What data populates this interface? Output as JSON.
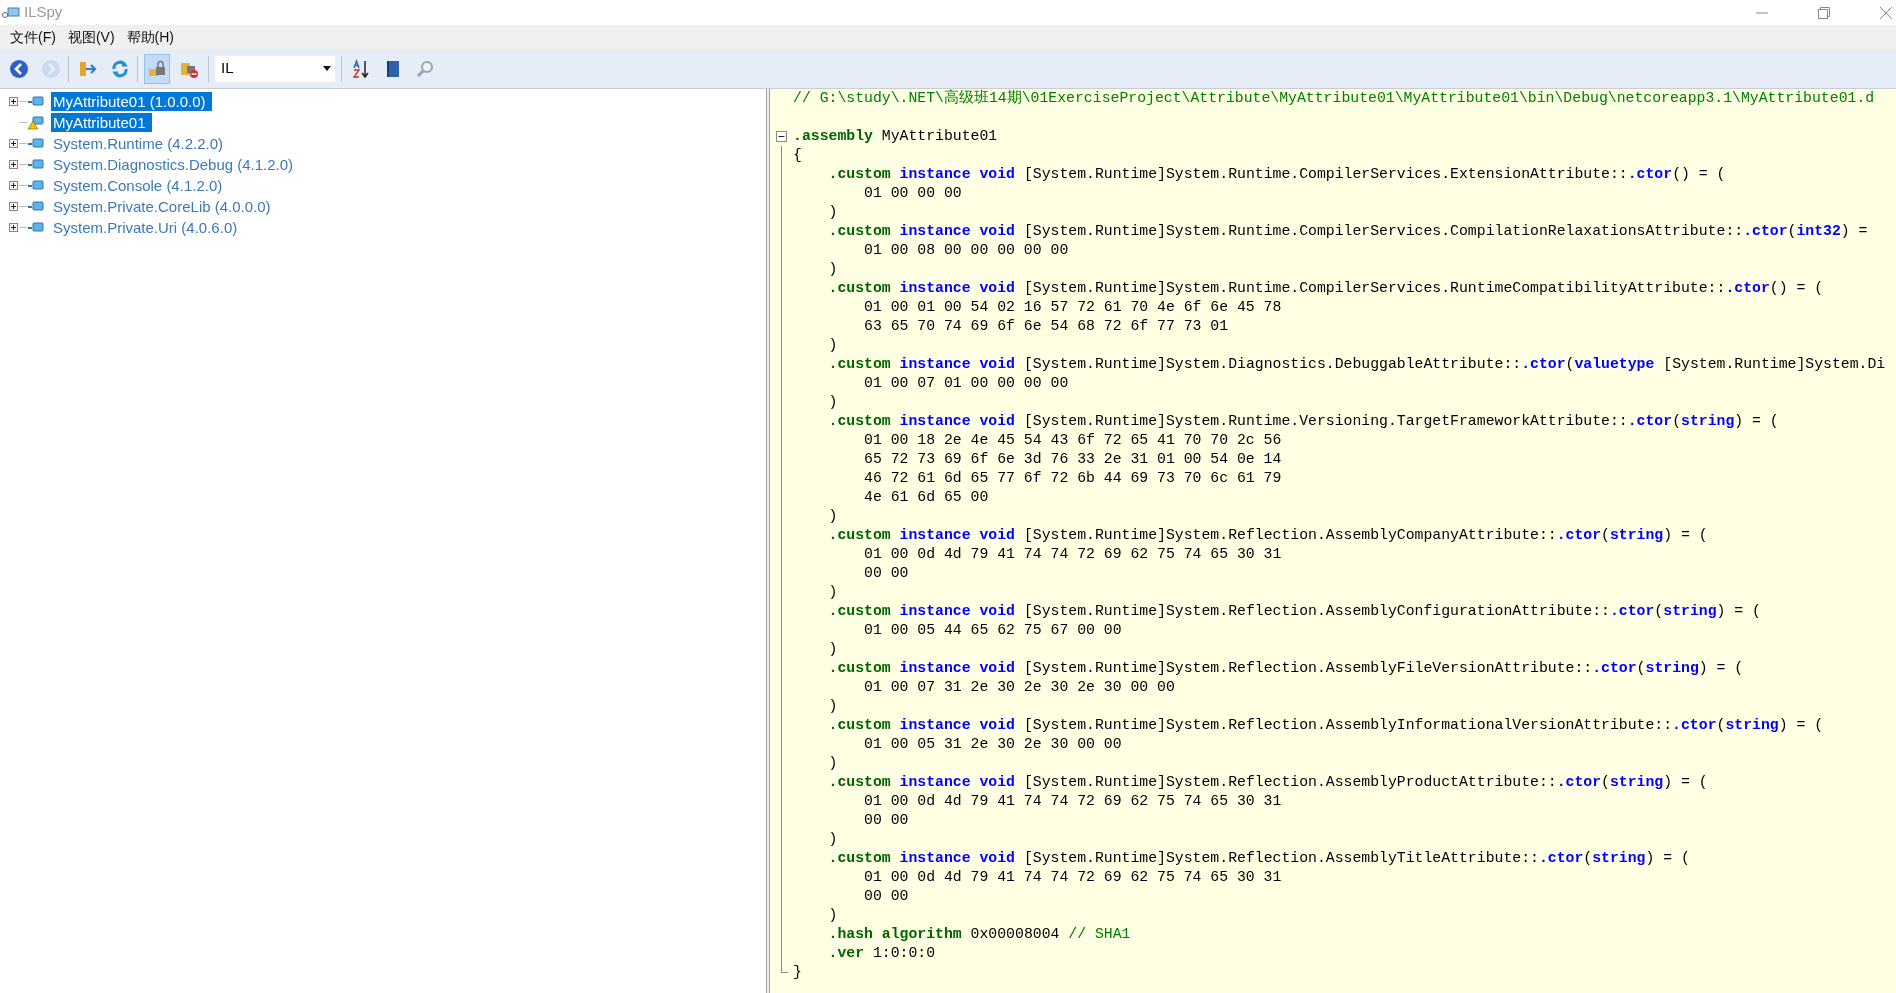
{
  "window": {
    "title": "ILSpy"
  },
  "menu": [
    "文件(F)",
    "视图(V)",
    "帮助(H)"
  ],
  "toolbar": {
    "buttons": [
      {
        "kind": "back",
        "disabled": false,
        "pressed": false
      },
      {
        "kind": "forward",
        "disabled": true,
        "pressed": false
      },
      {
        "kind": "open",
        "disabled": false,
        "pressed": false
      },
      {
        "kind": "reload",
        "disabled": false,
        "pressed": false
      },
      {
        "kind": "lock",
        "disabled": false,
        "pressed": true
      },
      {
        "kind": "lock-remove",
        "disabled": false,
        "pressed": false
      }
    ],
    "language": {
      "value": "IL"
    },
    "tools": [
      {
        "kind": "sort"
      },
      {
        "kind": "book"
      },
      {
        "kind": "search"
      }
    ]
  },
  "tree": {
    "items": [
      {
        "label": "MyAttribute01 (1.0.0.0)",
        "selected": true,
        "expandable": true,
        "kind": "assembly"
      },
      {
        "label": "MyAttribute01",
        "selected": true,
        "expandable": false,
        "kind": "warning"
      },
      {
        "label": "System.Runtime (4.2.2.0)",
        "selected": false,
        "expandable": true,
        "kind": "assembly"
      },
      {
        "label": "System.Diagnostics.Debug (4.1.2.0)",
        "selected": false,
        "expandable": true,
        "kind": "assembly"
      },
      {
        "label": "System.Console (4.1.2.0)",
        "selected": false,
        "expandable": true,
        "kind": "assembly"
      },
      {
        "label": "System.Private.CoreLib (4.0.0.0)",
        "selected": false,
        "expandable": true,
        "kind": "assembly"
      },
      {
        "label": "System.Private.Uri (4.0.6.0)",
        "selected": false,
        "expandable": true,
        "kind": "assembly"
      }
    ]
  },
  "code": {
    "lines": [
      {
        "kind": "code",
        "tokens": [
          {
            "kind": "comment",
            "text": "// G:\\study\\.NET\\高级班14期\\01ExerciseProject\\Attribute\\MyAttribute01\\MyAttribute01\\bin\\Debug\\netcoreapp3.1\\MyAttribute01.d"
          }
        ]
      },
      {
        "kind": "blank"
      },
      {
        "kind": "code",
        "expanded": true,
        "tokens": [
          {
            "kind": "directive",
            "text": ".assembly"
          },
          {
            "kind": "plain",
            "text": " MyAttribute01"
          }
        ]
      },
      {
        "kind": "code",
        "tokens": [
          {
            "kind": "plain",
            "text": "{"
          }
        ]
      },
      {
        "kind": "code",
        "tokens": [
          {
            "kind": "directive",
            "text": "    .custom"
          },
          {
            "kind": "keyword",
            "text": " instance void"
          },
          {
            "kind": "plain",
            "text": " [System.Runtime]System.Runtime.CompilerServices.ExtensionAttribute::"
          },
          {
            "kind": "keyword",
            "text": ".ctor"
          },
          {
            "kind": "plain",
            "text": "() = ("
          }
        ]
      },
      {
        "kind": "code",
        "tokens": [
          {
            "kind": "plain",
            "text": "        01 00 00 00"
          }
        ]
      },
      {
        "kind": "code",
        "tokens": [
          {
            "kind": "plain",
            "text": "    )"
          }
        ]
      },
      {
        "kind": "code",
        "tokens": [
          {
            "kind": "directive",
            "text": "    .custom"
          },
          {
            "kind": "keyword",
            "text": " instance void"
          },
          {
            "kind": "plain",
            "text": " [System.Runtime]System.Runtime.CompilerServices.CompilationRelaxationsAttribute::"
          },
          {
            "kind": "keyword",
            "text": ".ctor"
          },
          {
            "kind": "plain",
            "text": "("
          },
          {
            "kind": "keyword",
            "text": "int32"
          },
          {
            "kind": "plain",
            "text": ") ="
          }
        ]
      },
      {
        "kind": "code",
        "tokens": [
          {
            "kind": "plain",
            "text": "        01 00 08 00 00 00 00 00"
          }
        ]
      },
      {
        "kind": "code",
        "tokens": [
          {
            "kind": "plain",
            "text": "    )"
          }
        ]
      },
      {
        "kind": "code",
        "tokens": [
          {
            "kind": "directive",
            "text": "    .custom"
          },
          {
            "kind": "keyword",
            "text": " instance void"
          },
          {
            "kind": "plain",
            "text": " [System.Runtime]System.Runtime.CompilerServices.RuntimeCompatibilityAttribute::"
          },
          {
            "kind": "keyword",
            "text": ".ctor"
          },
          {
            "kind": "plain",
            "text": "() = ("
          }
        ]
      },
      {
        "kind": "code",
        "tokens": [
          {
            "kind": "plain",
            "text": "        01 00 01 00 54 02 16 57 72 61 70 4e 6f 6e 45 78"
          }
        ]
      },
      {
        "kind": "code",
        "tokens": [
          {
            "kind": "plain",
            "text": "        63 65 70 74 69 6f 6e 54 68 72 6f 77 73 01"
          }
        ]
      },
      {
        "kind": "code",
        "tokens": [
          {
            "kind": "plain",
            "text": "    )"
          }
        ]
      },
      {
        "kind": "code",
        "tokens": [
          {
            "kind": "directive",
            "text": "    .custom"
          },
          {
            "kind": "keyword",
            "text": " instance void"
          },
          {
            "kind": "plain",
            "text": " [System.Runtime]System.Diagnostics.DebuggableAttribute::"
          },
          {
            "kind": "keyword",
            "text": ".ctor"
          },
          {
            "kind": "plain",
            "text": "("
          },
          {
            "kind": "keyword",
            "text": "valuetype"
          },
          {
            "kind": "plain",
            "text": " [System.Runtime]System.Di"
          }
        ]
      },
      {
        "kind": "code",
        "tokens": [
          {
            "kind": "plain",
            "text": "        01 00 07 01 00 00 00 00"
          }
        ]
      },
      {
        "kind": "code",
        "tokens": [
          {
            "kind": "plain",
            "text": "    )"
          }
        ]
      },
      {
        "kind": "code",
        "tokens": [
          {
            "kind": "directive",
            "text": "    .custom"
          },
          {
            "kind": "keyword",
            "text": " instance void"
          },
          {
            "kind": "plain",
            "text": " [System.Runtime]System.Runtime.Versioning.TargetFrameworkAttribute::"
          },
          {
            "kind": "keyword",
            "text": ".ctor"
          },
          {
            "kind": "plain",
            "text": "("
          },
          {
            "kind": "keyword",
            "text": "string"
          },
          {
            "kind": "plain",
            "text": ") = ("
          }
        ]
      },
      {
        "kind": "code",
        "tokens": [
          {
            "kind": "plain",
            "text": "        01 00 18 2e 4e 45 54 43 6f 72 65 41 70 70 2c 56"
          }
        ]
      },
      {
        "kind": "code",
        "tokens": [
          {
            "kind": "plain",
            "text": "        65 72 73 69 6f 6e 3d 76 33 2e 31 01 00 54 0e 14"
          }
        ]
      },
      {
        "kind": "code",
        "tokens": [
          {
            "kind": "plain",
            "text": "        46 72 61 6d 65 77 6f 72 6b 44 69 73 70 6c 61 79"
          }
        ]
      },
      {
        "kind": "code",
        "tokens": [
          {
            "kind": "plain",
            "text": "        4e 61 6d 65 00"
          }
        ]
      },
      {
        "kind": "code",
        "tokens": [
          {
            "kind": "plain",
            "text": "    )"
          }
        ]
      },
      {
        "kind": "code",
        "tokens": [
          {
            "kind": "directive",
            "text": "    .custom"
          },
          {
            "kind": "keyword",
            "text": " instance void"
          },
          {
            "kind": "plain",
            "text": " [System.Runtime]System.Reflection.AssemblyCompanyAttribute::"
          },
          {
            "kind": "keyword",
            "text": ".ctor"
          },
          {
            "kind": "plain",
            "text": "("
          },
          {
            "kind": "keyword",
            "text": "string"
          },
          {
            "kind": "plain",
            "text": ") = ("
          }
        ]
      },
      {
        "kind": "code",
        "tokens": [
          {
            "kind": "plain",
            "text": "        01 00 0d 4d 79 41 74 74 72 69 62 75 74 65 30 31"
          }
        ]
      },
      {
        "kind": "code",
        "tokens": [
          {
            "kind": "plain",
            "text": "        00 00"
          }
        ]
      },
      {
        "kind": "code",
        "tokens": [
          {
            "kind": "plain",
            "text": "    )"
          }
        ]
      },
      {
        "kind": "code",
        "tokens": [
          {
            "kind": "directive",
            "text": "    .custom"
          },
          {
            "kind": "keyword",
            "text": " instance void"
          },
          {
            "kind": "plain",
            "text": " [System.Runtime]System.Reflection.AssemblyConfigurationAttribute::"
          },
          {
            "kind": "keyword",
            "text": ".ctor"
          },
          {
            "kind": "plain",
            "text": "("
          },
          {
            "kind": "keyword",
            "text": "string"
          },
          {
            "kind": "plain",
            "text": ") = ("
          }
        ]
      },
      {
        "kind": "code",
        "tokens": [
          {
            "kind": "plain",
            "text": "        01 00 05 44 65 62 75 67 00 00"
          }
        ]
      },
      {
        "kind": "code",
        "tokens": [
          {
            "kind": "plain",
            "text": "    )"
          }
        ]
      },
      {
        "kind": "code",
        "tokens": [
          {
            "kind": "directive",
            "text": "    .custom"
          },
          {
            "kind": "keyword",
            "text": " instance void"
          },
          {
            "kind": "plain",
            "text": " [System.Runtime]System.Reflection.AssemblyFileVersionAttribute::"
          },
          {
            "kind": "keyword",
            "text": ".ctor"
          },
          {
            "kind": "plain",
            "text": "("
          },
          {
            "kind": "keyword",
            "text": "string"
          },
          {
            "kind": "plain",
            "text": ") = ("
          }
        ]
      },
      {
        "kind": "code",
        "tokens": [
          {
            "kind": "plain",
            "text": "        01 00 07 31 2e 30 2e 30 2e 30 00 00"
          }
        ]
      },
      {
        "kind": "code",
        "tokens": [
          {
            "kind": "plain",
            "text": "    )"
          }
        ]
      },
      {
        "kind": "code",
        "tokens": [
          {
            "kind": "directive",
            "text": "    .custom"
          },
          {
            "kind": "keyword",
            "text": " instance void"
          },
          {
            "kind": "plain",
            "text": " [System.Runtime]System.Reflection.AssemblyInformationalVersionAttribute::"
          },
          {
            "kind": "keyword",
            "text": ".ctor"
          },
          {
            "kind": "plain",
            "text": "("
          },
          {
            "kind": "keyword",
            "text": "string"
          },
          {
            "kind": "plain",
            "text": ") = ("
          }
        ]
      },
      {
        "kind": "code",
        "tokens": [
          {
            "kind": "plain",
            "text": "        01 00 05 31 2e 30 2e 30 00 00"
          }
        ]
      },
      {
        "kind": "code",
        "tokens": [
          {
            "kind": "plain",
            "text": "    )"
          }
        ]
      },
      {
        "kind": "code",
        "tokens": [
          {
            "kind": "directive",
            "text": "    .custom"
          },
          {
            "kind": "keyword",
            "text": " instance void"
          },
          {
            "kind": "plain",
            "text": " [System.Runtime]System.Reflection.AssemblyProductAttribute::"
          },
          {
            "kind": "keyword",
            "text": ".ctor"
          },
          {
            "kind": "plain",
            "text": "("
          },
          {
            "kind": "keyword",
            "text": "string"
          },
          {
            "kind": "plain",
            "text": ") = ("
          }
        ]
      },
      {
        "kind": "code",
        "tokens": [
          {
            "kind": "plain",
            "text": "        01 00 0d 4d 79 41 74 74 72 69 62 75 74 65 30 31"
          }
        ]
      },
      {
        "kind": "code",
        "tokens": [
          {
            "kind": "plain",
            "text": "        00 00"
          }
        ]
      },
      {
        "kind": "code",
        "tokens": [
          {
            "kind": "plain",
            "text": "    )"
          }
        ]
      },
      {
        "kind": "code",
        "tokens": [
          {
            "kind": "directive",
            "text": "    .custom"
          },
          {
            "kind": "keyword",
            "text": " instance void"
          },
          {
            "kind": "plain",
            "text": " [System.Runtime]System.Reflection.AssemblyTitleAttribute::"
          },
          {
            "kind": "keyword",
            "text": ".ctor"
          },
          {
            "kind": "plain",
            "text": "("
          },
          {
            "kind": "keyword",
            "text": "string"
          },
          {
            "kind": "plain",
            "text": ") = ("
          }
        ]
      },
      {
        "kind": "code",
        "tokens": [
          {
            "kind": "plain",
            "text": "        01 00 0d 4d 79 41 74 74 72 69 62 75 74 65 30 31"
          }
        ]
      },
      {
        "kind": "code",
        "tokens": [
          {
            "kind": "plain",
            "text": "        00 00"
          }
        ]
      },
      {
        "kind": "code",
        "tokens": [
          {
            "kind": "plain",
            "text": "    )"
          }
        ]
      },
      {
        "kind": "code",
        "tokens": [
          {
            "kind": "directive",
            "text": "    .hash algorithm"
          },
          {
            "kind": "plain",
            "text": " 0x00008004 "
          },
          {
            "kind": "comment",
            "text": "// SHA1"
          }
        ]
      },
      {
        "kind": "code",
        "tokens": [
          {
            "kind": "directive",
            "text": "    .ver"
          },
          {
            "kind": "plain",
            "text": " 1:0:0:0"
          }
        ]
      },
      {
        "kind": "code",
        "tokens": [
          {
            "kind": "plain",
            "text": "}"
          }
        ]
      }
    ]
  }
}
